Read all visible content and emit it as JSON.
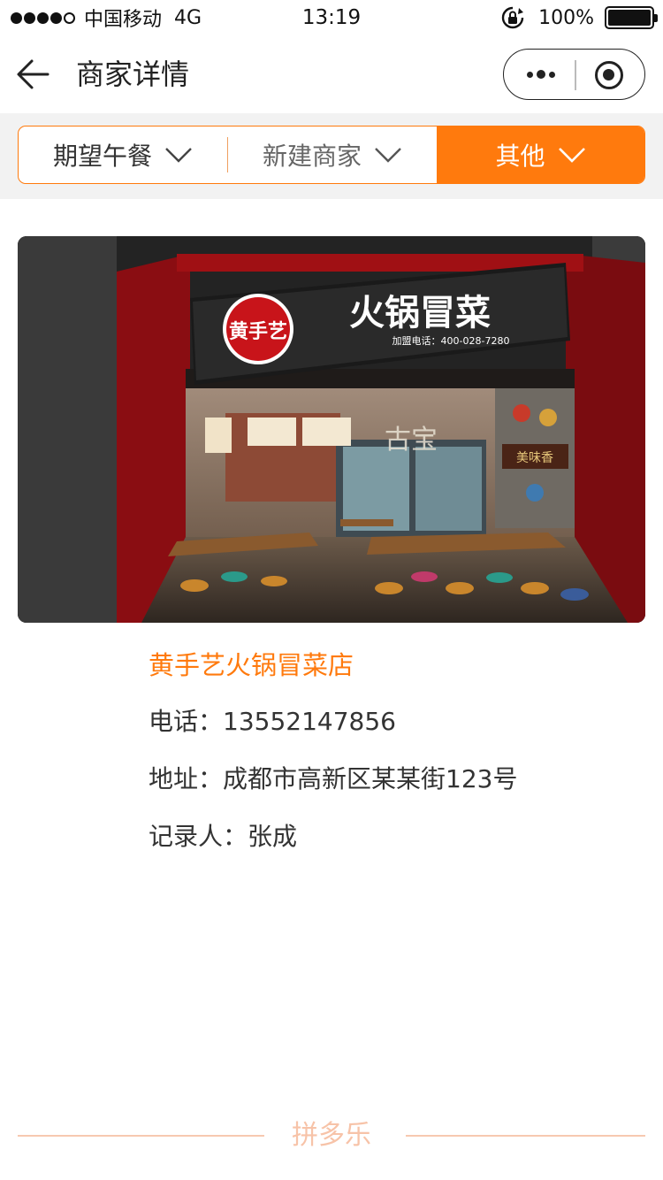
{
  "status_bar": {
    "signal_dots": 5,
    "signal_filled": 4,
    "carrier": "中国移动",
    "network": "4G",
    "time": "13:19",
    "battery_percent": "100%",
    "battery_level": 1.0,
    "icons": [
      "signal-icon",
      "rotation-lock-icon",
      "battery-icon"
    ]
  },
  "nav": {
    "title": "商家详情",
    "icons": [
      "back-arrow-icon",
      "more-dots-icon",
      "close-circle-icon"
    ]
  },
  "filters": {
    "tabs": [
      {
        "label": "期望午餐",
        "active": false
      },
      {
        "label": "新建商家",
        "active": false
      },
      {
        "label": "其他",
        "active": true
      }
    ],
    "dropdown_icon": "chevron-down-icon"
  },
  "store_photo": {
    "sign_text": "火锅冒菜",
    "logo_text": "黄手艺",
    "sign_phone": "加盟电话：400-028-7280",
    "wall_sign": "美味香",
    "window_text": "古宝"
  },
  "merchant": {
    "name": "黄手艺火锅冒菜店",
    "phone_label": "电话：",
    "phone": "13552147856",
    "address_label": "地址：",
    "address": "成都市高新区某某街123号",
    "recorder_label": "记录人：",
    "recorder": "张成"
  },
  "footer": {
    "brand": "拼多乐"
  },
  "colors": {
    "accent": "#ff7a0d",
    "footer_brand": "#f7c3a8",
    "filter_band": "#f2f2f2"
  }
}
